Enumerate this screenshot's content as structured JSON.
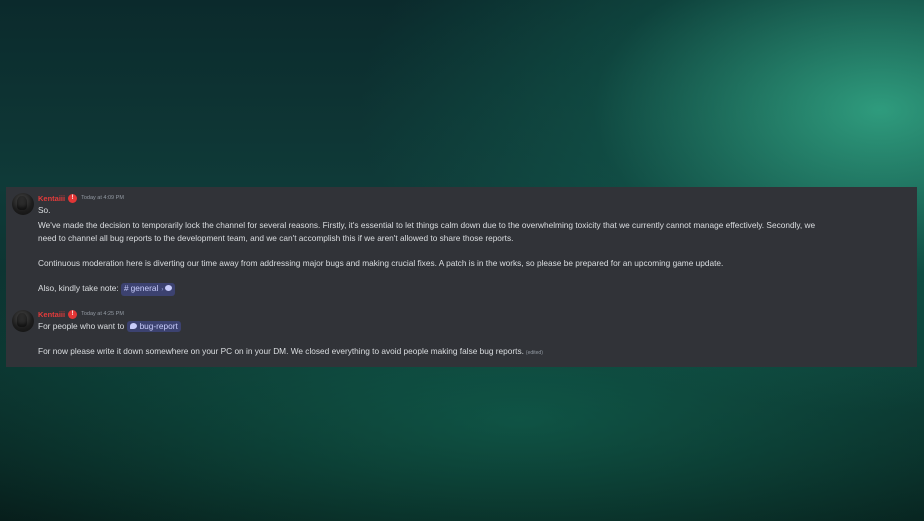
{
  "messages": [
    {
      "author": "Kentaiii",
      "timestamp": "Today at 4:09 PM",
      "lines": [
        "So.",
        "We've made the decision to temporarily lock the channel for several reasons. Firstly, it's essential to let things calm down due to the overwhelming toxicity that we currently cannot manage effectively. Secondly, we",
        "need to channel all bug reports to the development team, and we can't accomplish this if we aren't allowed to share those reports.",
        "Continuous moderation here is diverting our time away from addressing major bugs and making crucial fixes. A patch is in the works, so please be prepared for an upcoming game update."
      ],
      "note_prefix": "Also, kindly take note:",
      "channel_mention": "general",
      "thread_arrow": "›"
    },
    {
      "author": "Kentaiii",
      "timestamp": "Today at 4:25 PM",
      "line1_prefix": "For people who want to",
      "forum_mention": "bug-report",
      "line2": "For now please write it down somewhere on your PC on in your DM. We closed everything to avoid people making false bug reports.",
      "edited": "(edited)"
    }
  ],
  "colors": {
    "username": "#e33b3b",
    "message_bg": "#313338",
    "mention_bg": "#3c4270"
  }
}
